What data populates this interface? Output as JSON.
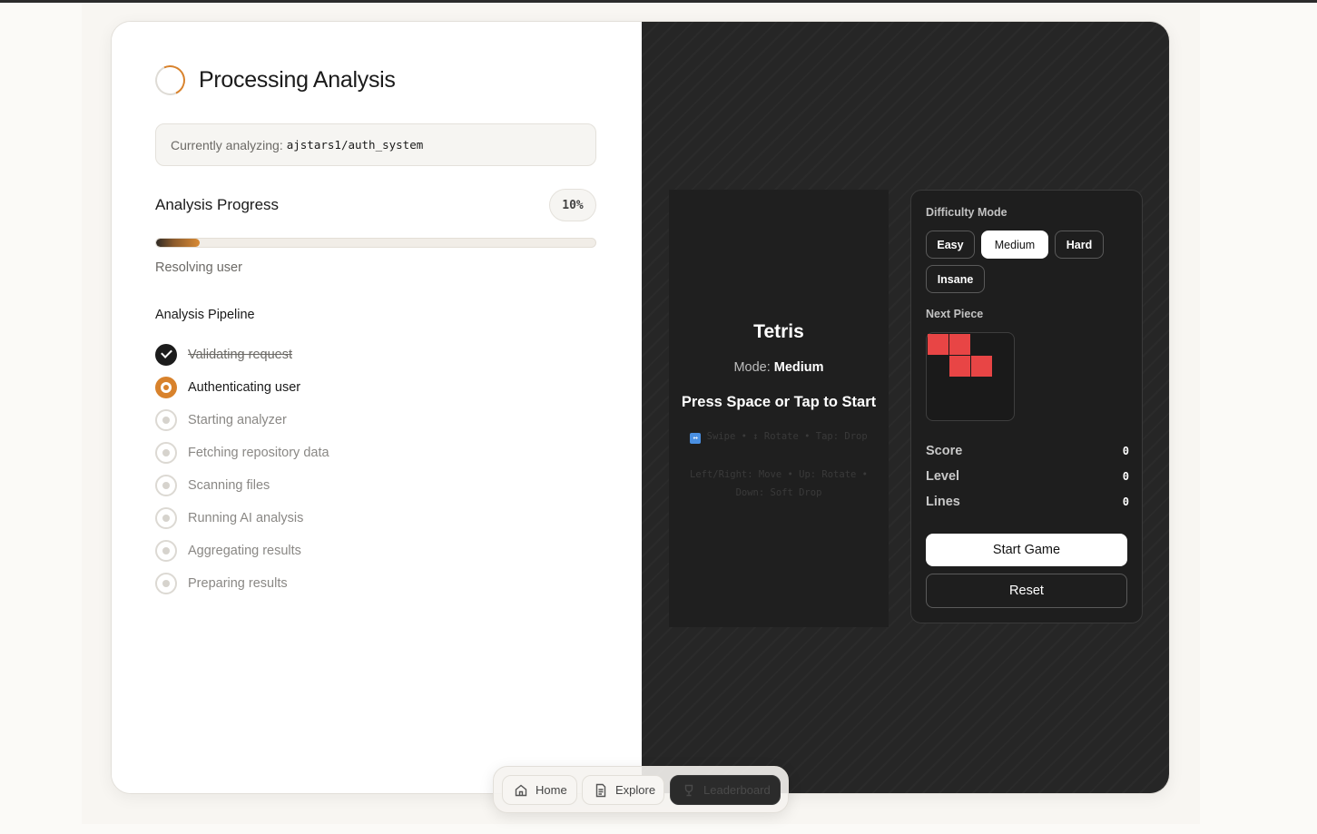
{
  "analysis": {
    "title": "Processing Analysis",
    "currently_label": "Currently analyzing:",
    "repo": "ajstars1/auth_system",
    "progress_title": "Analysis Progress",
    "progress_percent": "10%",
    "progress_value": 10,
    "status_text": "Resolving user",
    "pipeline_title": "Analysis Pipeline",
    "steps": [
      {
        "label": "Validating request",
        "state": "done"
      },
      {
        "label": "Authenticating user",
        "state": "active"
      },
      {
        "label": "Starting analyzer",
        "state": "pending"
      },
      {
        "label": "Fetching repository data",
        "state": "pending"
      },
      {
        "label": "Scanning files",
        "state": "pending"
      },
      {
        "label": "Running AI analysis",
        "state": "pending"
      },
      {
        "label": "Aggregating results",
        "state": "pending"
      },
      {
        "label": "Preparing results",
        "state": "pending"
      }
    ]
  },
  "game": {
    "title": "Tetris",
    "mode_label": "Mode:",
    "mode_value": "Medium",
    "start_prompt": "Press Space or Tap to Start",
    "hint_touch": "Swipe • ↕ Rotate • Tap: Drop",
    "hint_keys": "Left/Right: Move • Up: Rotate • Down: Soft Drop",
    "difficulty_label": "Difficulty Mode",
    "difficulties": [
      "Easy",
      "Medium",
      "Hard",
      "Insane"
    ],
    "selected_difficulty": "Medium",
    "next_piece_label": "Next Piece",
    "next_piece_color": "#e84545",
    "stats": [
      {
        "label": "Score",
        "value": "0"
      },
      {
        "label": "Level",
        "value": "0"
      },
      {
        "label": "Lines",
        "value": "0"
      }
    ],
    "start_button": "Start Game",
    "reset_button": "Reset"
  },
  "nav": {
    "home": "Home",
    "explore": "Explore",
    "leaderboard": "Leaderboard"
  },
  "colors": {
    "accent": "#d8822c",
    "dark_panel": "#262626",
    "piece_red": "#e84545"
  }
}
